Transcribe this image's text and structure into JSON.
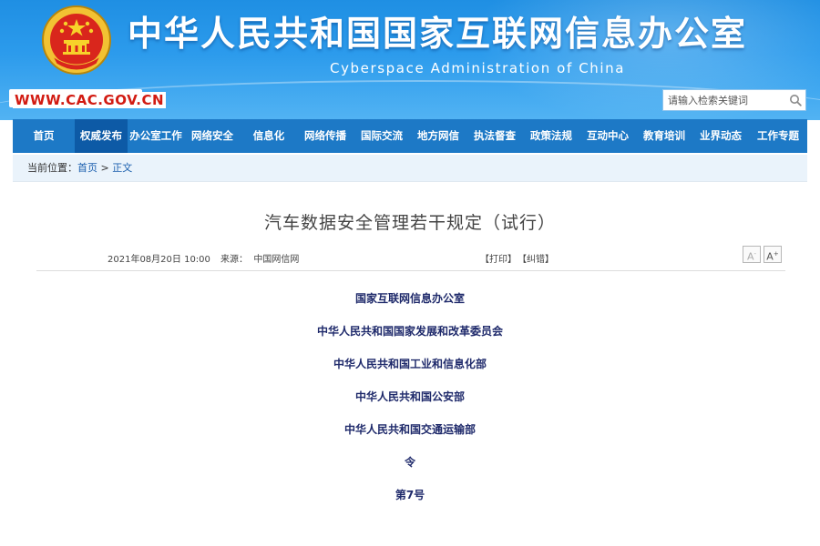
{
  "header": {
    "title": "中华人民共和国国家互联网信息办公室",
    "subtitle": "Cyberspace Administration of China",
    "url": "WWW.CAC.GOV.CN",
    "search_placeholder": "请输入检索关键词",
    "emblem_icon": "national-emblem-icon",
    "colors": {
      "banner": "#2c9bec",
      "nav": "#1d79c6",
      "nav_active": "#0d5aa6",
      "url_red": "#d21b12"
    }
  },
  "nav": {
    "items": [
      {
        "label": "首页"
      },
      {
        "label": "权威发布"
      },
      {
        "label": "办公室工作"
      },
      {
        "label": "网络安全"
      },
      {
        "label": "信息化"
      },
      {
        "label": "网络传播"
      },
      {
        "label": "国际交流"
      },
      {
        "label": "地方网信"
      },
      {
        "label": "执法督查"
      },
      {
        "label": "政策法规"
      },
      {
        "label": "互动中心"
      },
      {
        "label": "教育培训"
      },
      {
        "label": "业界动态"
      },
      {
        "label": "工作专题"
      }
    ],
    "active_index": 1
  },
  "breadcrumb": {
    "prefix": "当前位置：",
    "home": "首页",
    "sep": " > ",
    "current": "正文"
  },
  "article": {
    "title": "汽车数据安全管理若干规定（试行）",
    "date": "2021年08月20日 10:00",
    "source": "来源：  中国网信网",
    "print": "【打印】",
    "correct": "【纠错】",
    "font_small": "A",
    "font_big": "A",
    "lines": [
      "国家互联网信息办公室",
      "中华人民共和国国家发展和改革委员会",
      "中华人民共和国工业和信息化部",
      "中华人民共和国公安部",
      "中华人民共和国交通运输部",
      "令",
      "第7号"
    ]
  }
}
